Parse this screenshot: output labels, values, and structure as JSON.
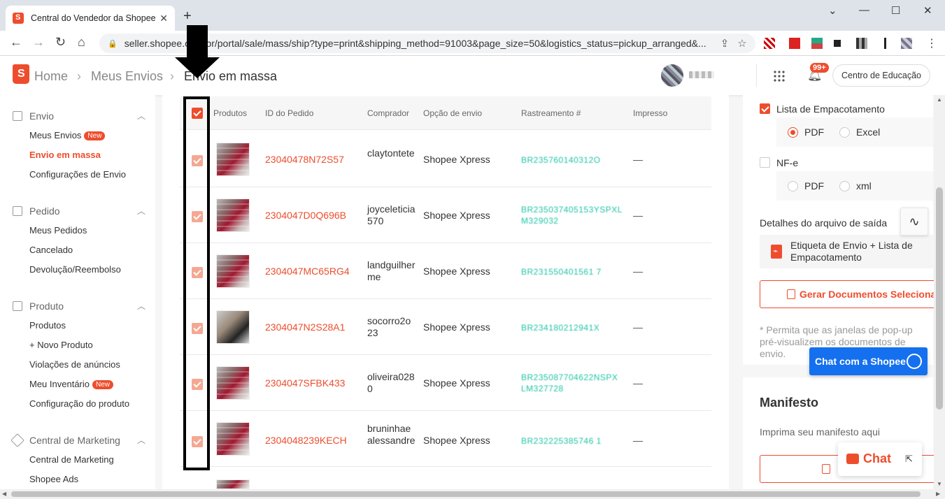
{
  "browser": {
    "tab_title": "Central do Vendedor da Shopee",
    "tab_close": "✕",
    "new_tab": "+",
    "url": "seller.shopee.com.br/portal/sale/mass/ship?type=print&shipping_method=91003&page_size=50&logistics_status=pickup_arranged&...",
    "window_controls": [
      "⌄",
      "—",
      "☐",
      "✕"
    ],
    "nav": {
      "back": "←",
      "forward": "→",
      "reload": "↻",
      "home": "⌂"
    }
  },
  "header": {
    "breadcrumbs": [
      "Home",
      "Meus Envios",
      "Envio em massa"
    ],
    "separator": "›",
    "notification_badge": "99+",
    "education_button": "Centro de Educação"
  },
  "sidebar": {
    "sections": [
      {
        "title": "Envio",
        "icon": "truck-icon",
        "items": [
          {
            "label": "Meus Envios",
            "badge": "New"
          },
          {
            "label": "Envio em massa",
            "active": true
          },
          {
            "label": "Configurações de Envio"
          }
        ]
      },
      {
        "title": "Pedido",
        "icon": "clipboard-icon",
        "items": [
          {
            "label": "Meus Pedidos"
          },
          {
            "label": "Cancelado"
          },
          {
            "label": "Devolução/Reembolso"
          }
        ]
      },
      {
        "title": "Produto",
        "icon": "box-icon",
        "items": [
          {
            "label": "Produtos"
          },
          {
            "label": "+ Novo Produto"
          },
          {
            "label": "Violações de anúncios"
          },
          {
            "label": "Meu Inventário",
            "badge": "New"
          },
          {
            "label": "Configuração do produto"
          }
        ]
      },
      {
        "title": "Central de Marketing",
        "icon": "tag-icon",
        "items": [
          {
            "label": "Central de Marketing"
          },
          {
            "label": "Shopee Ads"
          }
        ]
      }
    ]
  },
  "table": {
    "columns": [
      "Produtos",
      "ID do Pedido",
      "Comprador",
      "Opção de envio",
      "Rastreamento #",
      "Impresso"
    ],
    "rows": [
      {
        "order_id": "23040478N72S57",
        "buyer": "claytontete",
        "shipping": "Shopee Xpress",
        "tracking": "BR235760140312O",
        "printed": "—"
      },
      {
        "order_id": "2304047D0Q696B",
        "buyer": "joyceleticia570",
        "shipping": "Shopee Xpress",
        "tracking": "BR235037405153YSPXLM329032",
        "printed": "—"
      },
      {
        "order_id": "2304047MC65RG4",
        "buyer": "landguilherme",
        "shipping": "Shopee Xpress",
        "tracking": "BR231550401561 7",
        "printed": "—"
      },
      {
        "order_id": "2304047N2S28A1",
        "buyer": "socorro2o23",
        "shipping": "Shopee Xpress",
        "tracking": "BR234180212941X",
        "printed": "—"
      },
      {
        "order_id": "2304047SFBK433",
        "buyer": "oliveira0280",
        "shipping": "Shopee Xpress",
        "tracking": "BR235087704622NSPXLM327728",
        "printed": "—"
      },
      {
        "order_id": "2304048239KECH",
        "buyer": "bruninhaealessandre",
        "shipping": "Shopee Xpress",
        "tracking": "BR232225385746 1",
        "printed": "—"
      }
    ]
  },
  "right_panel": {
    "packing_list": "Lista de Empacotamento",
    "packing_opts": [
      "PDF",
      "Excel"
    ],
    "nfe": "NF-e",
    "nfe_opts": [
      "PDF",
      "xml"
    ],
    "file_details_label": "Detalhes do arquivo de saída",
    "file_name": "Etiqueta de Envio + Lista de Empacotamento",
    "generate_button": "Gerar Documentos Selecionados",
    "note": "* Permita que as janelas de pop-up pré-visualizem os documentos de envio.",
    "pulse_icon": "∿"
  },
  "manifest": {
    "title": "Manifesto",
    "subtitle": "Imprima seu manifesto aqui"
  },
  "chat": {
    "shopee_chat": "Chat com a Shopee",
    "chat_label": "Chat",
    "minimize": "⇱"
  },
  "colors": {
    "brand": "#ee4d2d",
    "tracking": "#20c5a5",
    "chat_blue": "#1570ef"
  }
}
